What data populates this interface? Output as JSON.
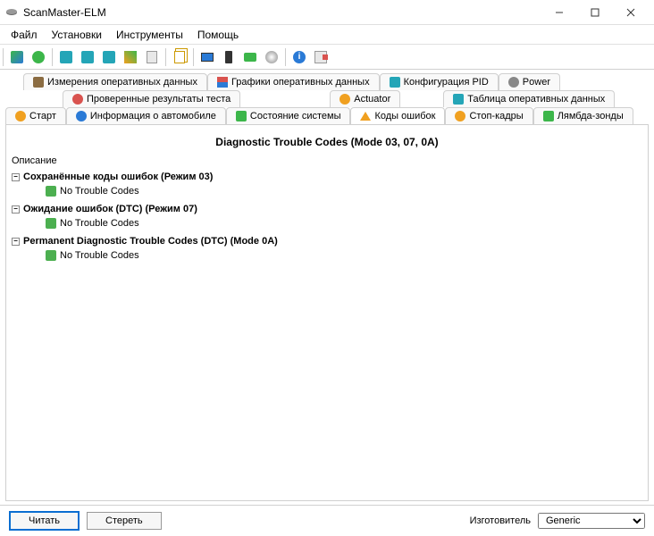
{
  "window": {
    "title": "ScanMaster-ELM"
  },
  "menu": {
    "file": "Файл",
    "settings": "Установки",
    "tools": "Инструменты",
    "help": "Помощь"
  },
  "tabs_row1": [
    {
      "label": "Измерения оперативных данных"
    },
    {
      "label": "Графики оперативных данных"
    },
    {
      "label": "Конфигурация PID"
    },
    {
      "label": "Power"
    }
  ],
  "tabs_row2": [
    {
      "label": "Проверенные результаты теста"
    },
    {
      "label": "Actuator"
    },
    {
      "label": "Таблица оперативных данных"
    }
  ],
  "tabs_row3": [
    {
      "label": "Старт"
    },
    {
      "label": "Информация о автомобиле"
    },
    {
      "label": "Состояние системы"
    },
    {
      "label": "Коды ошибок",
      "active": true
    },
    {
      "label": "Стоп-кадры"
    },
    {
      "label": "Лямбда-зонды"
    }
  ],
  "content": {
    "heading": "Diagnostic Trouble Codes (Mode 03, 07, 0A)",
    "description_label": "Описание",
    "groups": [
      {
        "title": "Сохранённые коды ошибок (Режим 03)",
        "leaf": "No Trouble Codes"
      },
      {
        "title": "Ожидание ошибок (DTC) (Режим 07)",
        "leaf": "No Trouble Codes"
      },
      {
        "title": "Permanent Diagnostic Trouble Codes (DTC) (Mode 0A)",
        "leaf": "No Trouble Codes"
      }
    ]
  },
  "bottom": {
    "read": "Читать",
    "erase": "Стереть",
    "manufacturer_label": "Изготовитель",
    "manufacturer_value": "Generic"
  }
}
